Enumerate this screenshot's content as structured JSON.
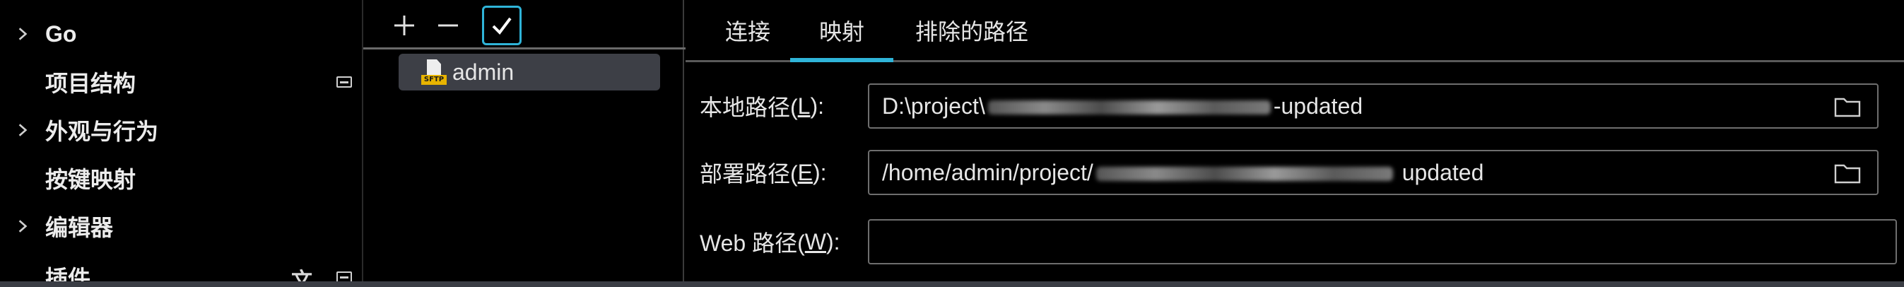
{
  "settings_tree": {
    "items": [
      {
        "label": "Go",
        "expandable": true
      },
      {
        "label": "项目结构",
        "expandable": false
      },
      {
        "label": "外观与行为",
        "expandable": true
      },
      {
        "label": "按键映射",
        "expandable": false
      },
      {
        "label": "编辑器",
        "expandable": true
      },
      {
        "label": "插件",
        "expandable": false
      }
    ]
  },
  "server_panel": {
    "toolbar": {
      "add_icon": "plus-icon",
      "remove_icon": "minus-icon",
      "default_icon": "check-icon"
    },
    "servers": [
      {
        "name": "admin",
        "type_tag": "SFTP"
      }
    ]
  },
  "config_panel": {
    "tabs": [
      {
        "label": "连接"
      },
      {
        "label": "映射"
      },
      {
        "label": "排除的路径"
      }
    ],
    "active_tab": "映射",
    "fields": {
      "local_path": {
        "label_prefix": "本地路径(",
        "mnemonic": "L",
        "label_suffix": "):",
        "value_prefix": "D:\\project\\",
        "value_suffix": "-updated"
      },
      "deploy_path": {
        "label_prefix": "部署路径(",
        "mnemonic": "E",
        "label_suffix": "):",
        "value_prefix": "/home/admin/project/",
        "value_suffix": " updated"
      },
      "web_path": {
        "label_prefix": "Web 路径(",
        "mnemonic": "W",
        "label_suffix": "):",
        "value": ""
      }
    }
  },
  "colors": {
    "accent": "#2fb4d8",
    "background": "#000000",
    "selected_item_bg": "#3d3f46",
    "sftp_tag": "#e8b400"
  }
}
